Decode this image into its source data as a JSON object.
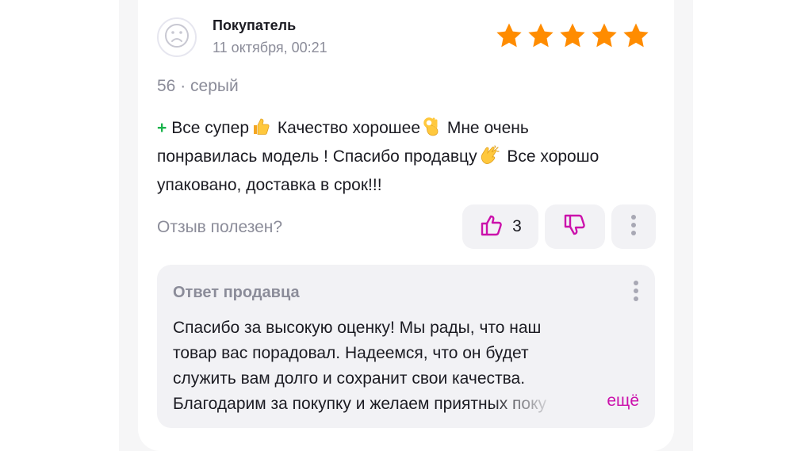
{
  "review": {
    "author": "Покупатель",
    "date": "11 октября, 00:21",
    "rating": 5,
    "variant": "56 · серый",
    "plus_marker": "+",
    "text_parts": [
      "Все супер",
      " Качество хорошее",
      " Мне очень понравилась модель ! Спасибо продавцу",
      " Все хорошо упаковано, доставка в срок!!!"
    ],
    "emojis": [
      "thumbs-up-emoji",
      "ok-hand-emoji",
      "clapping-hands-emoji"
    ],
    "helpful_question": "Отзыв полезен?",
    "likes": "3",
    "icons": {
      "avatar": "sad-face-icon",
      "like": "thumbs-up-icon",
      "dislike": "thumbs-down-icon",
      "more": "vertical-dots-icon",
      "star": "star-icon"
    }
  },
  "seller_reply": {
    "title": "Ответ продавца",
    "lines": [
      "Спасибо за высокую оценку! Мы рады, что наш",
      "товар вас порадовал. Надеемся, что он будет",
      "служить вам долго и сохранит свои качества.",
      "Благодарим за покупку и желаем приятных поку"
    ],
    "more_label": "ещё"
  },
  "colors": {
    "star": "#ff8c00",
    "accent": "#cb11ab",
    "positive": "#19b34b",
    "muted_text": "#8b8c99",
    "text": "#1b1b22",
    "button_bg": "#f2f2f5"
  }
}
